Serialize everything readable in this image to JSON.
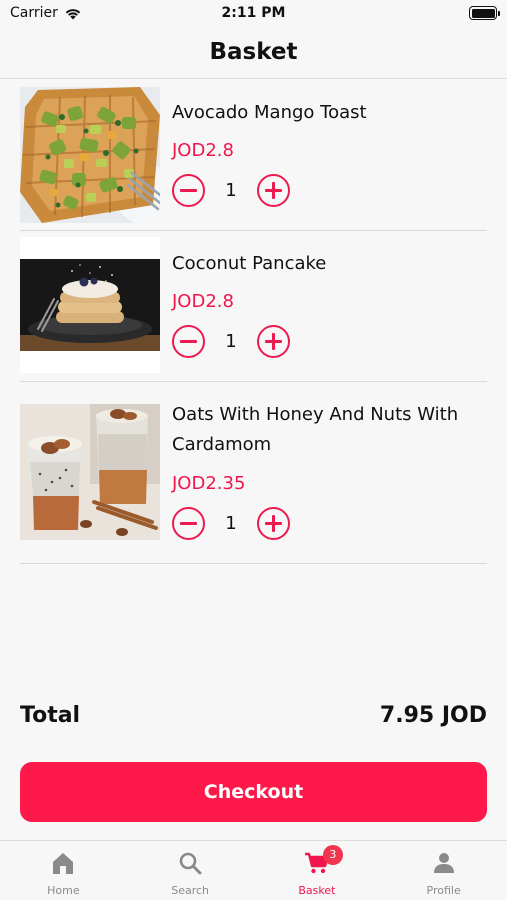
{
  "status_bar": {
    "carrier": "Carrier",
    "time": "2:11 PM"
  },
  "header": {
    "title": "Basket"
  },
  "items": [
    {
      "name": "Avocado Mango Toast",
      "price": "JOD2.8",
      "quantity": "1",
      "image": "avocado-toast-photo"
    },
    {
      "name": "Coconut Pancake",
      "price": "JOD2.8",
      "quantity": "1",
      "image": "coconut-pancake-photo"
    },
    {
      "name": "Oats With Honey And Nuts With Cardamom",
      "price": "JOD2.35",
      "quantity": "1",
      "image": "oats-jar-photo"
    }
  ],
  "summary": {
    "total_label": "Total",
    "total_value": "7.95 JOD"
  },
  "checkout_label": "Checkout",
  "tabbar": {
    "tabs": [
      {
        "label": "Home",
        "icon": "home-icon"
      },
      {
        "label": "Search",
        "icon": "search-icon"
      },
      {
        "label": "Basket",
        "icon": "cart-icon",
        "badge": "3",
        "active": true
      },
      {
        "label": "Profile",
        "icon": "person-icon"
      }
    ]
  },
  "colors": {
    "accent": "#f0164c",
    "checkout": "#fd1a4a",
    "background": "#f7f7f7"
  }
}
